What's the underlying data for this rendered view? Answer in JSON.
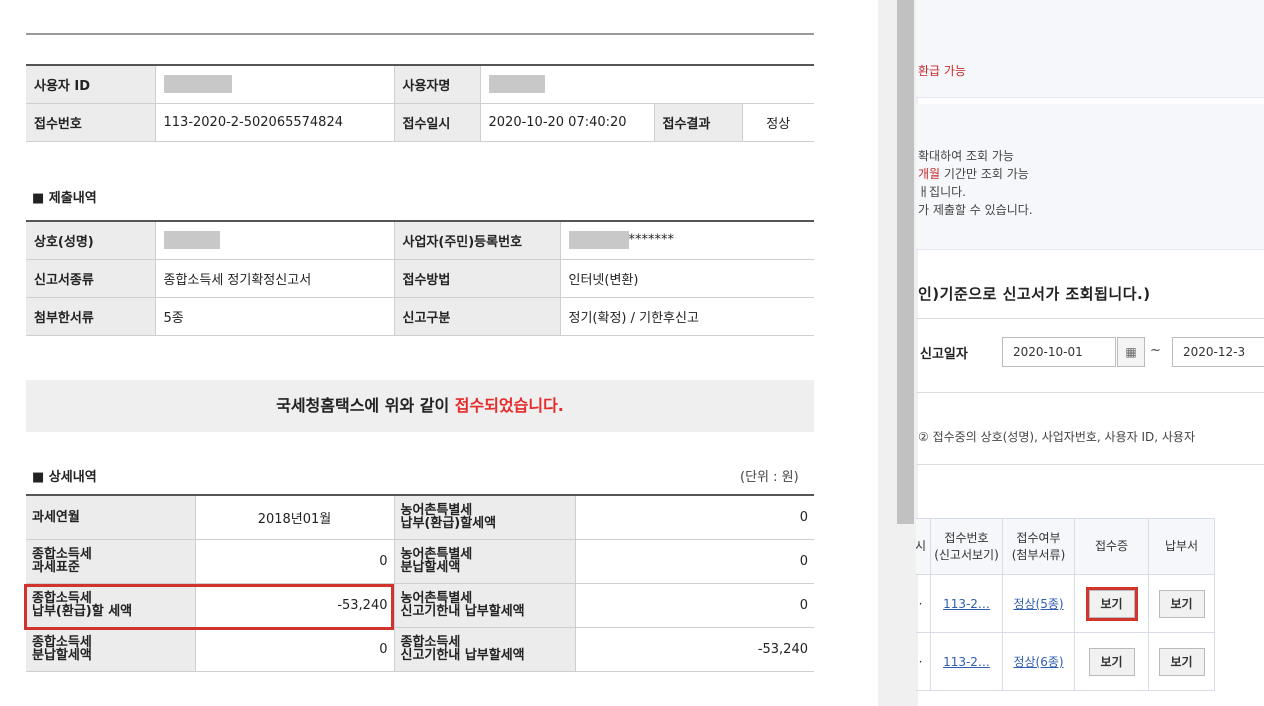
{
  "receipt": {
    "row1": {
      "user_id_label": "사용자 ID",
      "user_name_label": "사용자명"
    },
    "row2": {
      "receipt_no_label": "접수번호",
      "receipt_no": "113-2020-2-502065574824",
      "receipt_time_label": "접수일시",
      "receipt_time": "2020-10-20 07:40:20",
      "result_label": "접수결과",
      "result": "정상"
    }
  },
  "submission": {
    "title": "■ 제출내역",
    "company_label": "상호(성명)",
    "biz_no_label": "사업자(주민)등록번호",
    "biz_no_masked": "*******",
    "report_type_label": "신고서종류",
    "report_type": "종합소득세 정기확정신고서",
    "method_label": "접수방법",
    "method": "인터넷(변환)",
    "attach_label": "첨부한서류",
    "attach": "5종",
    "category_label": "신고구분",
    "category": "정기(확정) / 기한후신고"
  },
  "banner": {
    "prefix": "국세청홈택스에 위와 같이 ",
    "highlight": "접수되었습니다."
  },
  "detail": {
    "title": "■ 상세내역",
    "unit": "(단위 : 원)",
    "rows": [
      {
        "l1": "과세연월",
        "l2": "",
        "v1": "2018년01월",
        "r1": "농어촌특별세",
        "r2": "납부(환급)할세액",
        "v2": "0"
      },
      {
        "l1": "종합소득세",
        "l2": "과세표준",
        "v1": "0",
        "r1": "농어촌특별세",
        "r2": "분납할세액",
        "v2": "0"
      },
      {
        "l1": "종합소득세",
        "l2": "납부(환급)할 세액",
        "v1": "-53,240",
        "r1": "농어촌특별세",
        "r2": "신고기한내 납부할세액",
        "v2": "0"
      },
      {
        "l1": "종합소득세",
        "l2": "분납할세액",
        "v1": "0",
        "r1": "종합소득세",
        "r2": "신고기한내 납부할세액",
        "v2": "-53,240"
      }
    ]
  },
  "right": {
    "refund_note": "환급 가능",
    "info_lines": [
      "확대하여 조회 가능",
      "기간만 조회 가능",
      "ㅐ집니다.",
      "가 제출할 수 있습니다."
    ],
    "info_red": "개월",
    "heading": "인)기준으로  신고서가 조회됩니다.)",
    "date_label": "신고일자",
    "date_from": "2020-10-01",
    "date_to": "2020-12-3",
    "tilde": "~",
    "note": "② 접수중의 상호(성명), 사업자번호, 사용자 ID, 사용자",
    "table": {
      "headers": [
        "시",
        "접수번호\n(신고서보기)",
        "접수여부\n(첨부서류)",
        "접수증",
        "납부서"
      ],
      "rows": [
        {
          "c0": "·",
          "no": "113-2…",
          "status": "정상(5종)",
          "receipt": "보기",
          "pay": "보기"
        },
        {
          "c0": "·",
          "no": "113-2…",
          "status": "정상(6종)",
          "receipt": "보기",
          "pay": "보기"
        }
      ]
    }
  }
}
